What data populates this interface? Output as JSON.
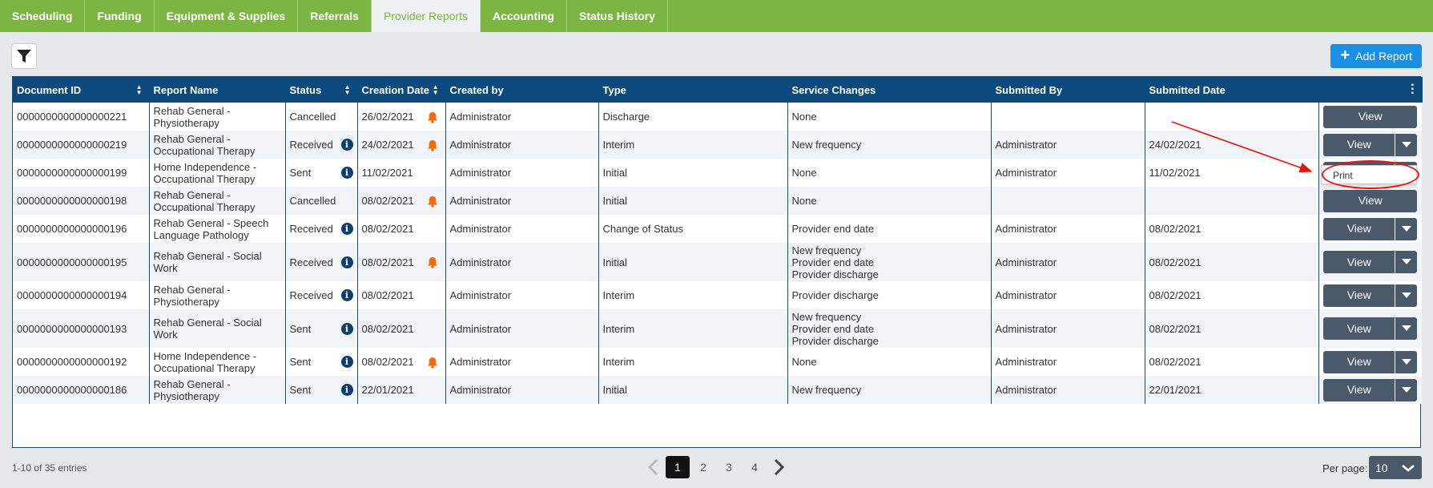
{
  "tabs": [
    {
      "label": "Scheduling",
      "active": false
    },
    {
      "label": "Funding",
      "active": false
    },
    {
      "label": "Equipment & Supplies",
      "active": false
    },
    {
      "label": "Referrals",
      "active": false
    },
    {
      "label": "Provider Reports",
      "active": true
    },
    {
      "label": "Accounting",
      "active": false
    },
    {
      "label": "Status History",
      "active": false
    }
  ],
  "toolbar": {
    "filter_icon": "filter-icon",
    "add_report_label": "Add Report"
  },
  "table": {
    "columns": [
      "Document ID",
      "Report Name",
      "Status",
      "Creation Date",
      "Created by",
      "Type",
      "Service Changes",
      "Submitted By",
      "Submitted Date",
      ""
    ],
    "sortable": [
      true,
      false,
      true,
      true,
      false,
      false,
      false,
      false,
      false,
      false
    ],
    "rows": [
      {
        "doc_id": "0000000000000000221",
        "report_name": "Rehab General - Physiotherapy",
        "status": "Cancelled",
        "info": false,
        "created": "26/02/2021",
        "bell": true,
        "created_by": "Administrator",
        "type": "Discharge",
        "service_changes": "None",
        "submitted_by": "",
        "submitted_date": "",
        "view": "View",
        "split": false
      },
      {
        "doc_id": "0000000000000000219",
        "report_name": "Rehab General - Occupational Therapy",
        "status": "Received",
        "info": true,
        "created": "24/02/2021",
        "bell": true,
        "created_by": "Administrator",
        "type": "Interim",
        "service_changes": "New frequency",
        "submitted_by": "Administrator",
        "submitted_date": "24/02/2021",
        "view": "View",
        "split": true
      },
      {
        "doc_id": "0000000000000000199",
        "report_name": "Home Independence - Occupational Therapy",
        "status": "Sent",
        "info": true,
        "created": "11/02/2021",
        "bell": false,
        "created_by": "Administrator",
        "type": "Initial",
        "service_changes": "None",
        "submitted_by": "Administrator",
        "submitted_date": "11/02/2021",
        "view": "View",
        "split": true
      },
      {
        "doc_id": "0000000000000000198",
        "report_name": "Rehab General - Occupational Therapy",
        "status": "Cancelled",
        "info": false,
        "created": "08/02/2021",
        "bell": true,
        "created_by": "Administrator",
        "type": "Initial",
        "service_changes": "None",
        "submitted_by": "",
        "submitted_date": "",
        "view": "View",
        "split": false
      },
      {
        "doc_id": "0000000000000000196",
        "report_name": "Rehab General - Speech Language Pathology",
        "status": "Received",
        "info": true,
        "created": "08/02/2021",
        "bell": false,
        "created_by": "Administrator",
        "type": "Change of Status",
        "service_changes": "Provider end date",
        "submitted_by": "Administrator",
        "submitted_date": "08/02/2021",
        "view": "View",
        "split": true
      },
      {
        "doc_id": "0000000000000000195",
        "report_name": "Rehab General - Social Work",
        "status": "Received",
        "info": true,
        "created": "08/02/2021",
        "bell": true,
        "created_by": "Administrator",
        "type": "Initial",
        "service_changes": "New frequency\nProvider end date\nProvider discharge",
        "submitted_by": "Administrator",
        "submitted_date": "08/02/2021",
        "view": "View",
        "split": true
      },
      {
        "doc_id": "0000000000000000194",
        "report_name": "Rehab General - Physiotherapy",
        "status": "Received",
        "info": true,
        "created": "08/02/2021",
        "bell": false,
        "created_by": "Administrator",
        "type": "Interim",
        "service_changes": "Provider discharge",
        "submitted_by": "Administrator",
        "submitted_date": "08/02/2021",
        "view": "View",
        "split": true
      },
      {
        "doc_id": "0000000000000000193",
        "report_name": "Rehab General - Social Work",
        "status": "Sent",
        "info": true,
        "created": "08/02/2021",
        "bell": false,
        "created_by": "Administrator",
        "type": "Interim",
        "service_changes": "New frequency\nProvider end date\nProvider discharge",
        "submitted_by": "Administrator",
        "submitted_date": "08/02/2021",
        "view": "View",
        "split": true
      },
      {
        "doc_id": "0000000000000000192",
        "report_name": "Home Independence - Occupational Therapy",
        "status": "Sent",
        "info": true,
        "created": "08/02/2021",
        "bell": true,
        "created_by": "Administrator",
        "type": "Interim",
        "service_changes": "None",
        "submitted_by": "Administrator",
        "submitted_date": "08/02/2021",
        "view": "View",
        "split": true
      },
      {
        "doc_id": "0000000000000000186",
        "report_name": "Rehab General - Physiotherapy",
        "status": "Sent",
        "info": true,
        "created": "22/01/2021",
        "bell": false,
        "created_by": "Administrator",
        "type": "Initial",
        "service_changes": "New frequency",
        "submitted_by": "Administrator",
        "submitted_date": "22/01/2021",
        "view": "View",
        "split": true
      }
    ]
  },
  "dropdown": {
    "item": "Print"
  },
  "annotation": {
    "color": "#e11111"
  },
  "footer": {
    "entries_text": "1-10 of 35 entries",
    "pages": [
      "1",
      "2",
      "3",
      "4"
    ],
    "active_page": "1",
    "per_page_label": "Per page:",
    "per_page_value": "10"
  },
  "colors": {
    "tabbar": "#7db543",
    "header": "#0c4a7e",
    "button": "#4a5a6a",
    "accent": "#1a8fe3",
    "bell": "#f26c0d"
  }
}
